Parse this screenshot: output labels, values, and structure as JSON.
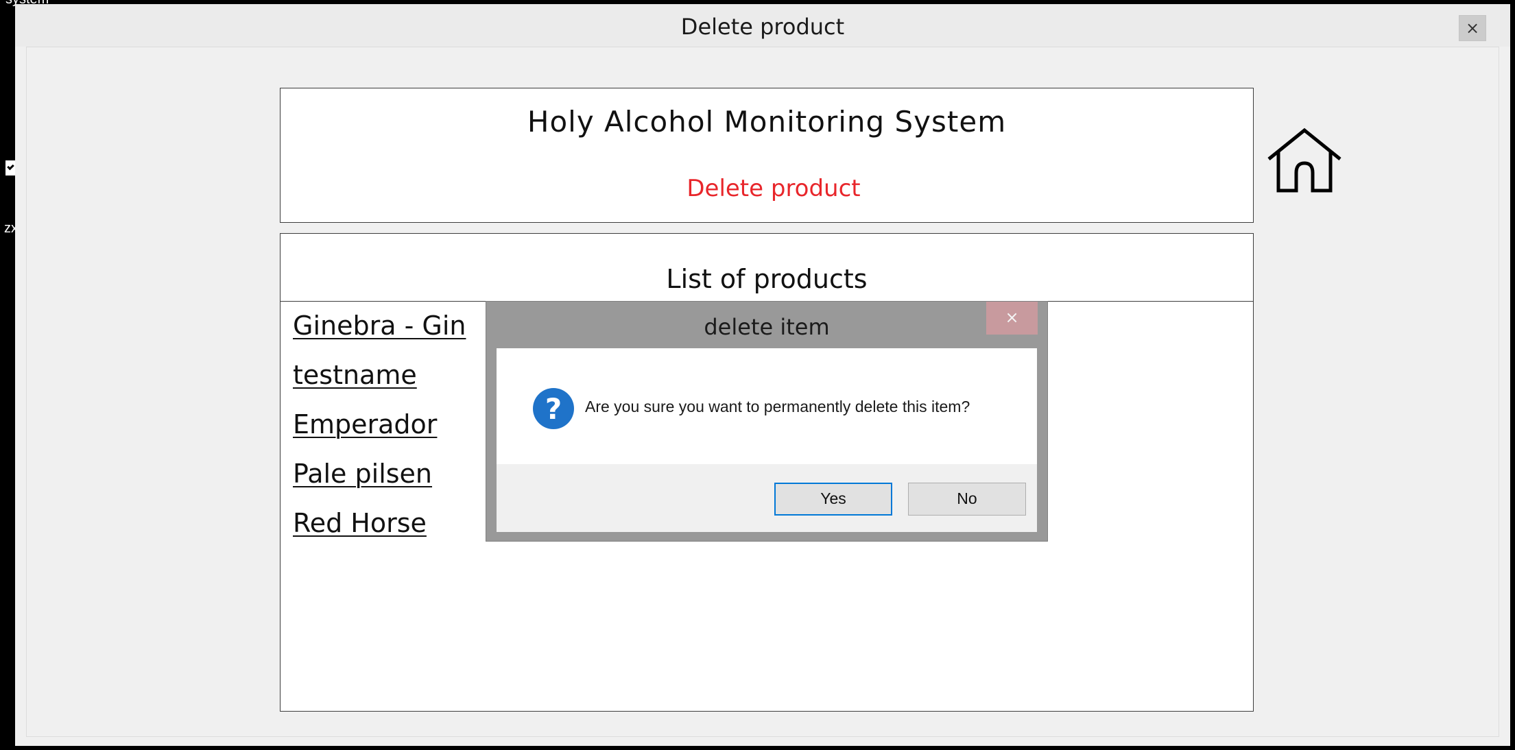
{
  "desktop": {
    "top_text": "system",
    "side_text": "zx"
  },
  "window": {
    "title": "Delete product",
    "close_glyph": "×"
  },
  "header": {
    "app_title": "Holy Alcohol Monitoring System",
    "page_subtitle": "Delete product",
    "subtitle_color": "#e8262b"
  },
  "home": {
    "icon": "home-icon"
  },
  "product_list": {
    "title": "List of products",
    "items": [
      "Ginebra - Gin",
      "testname",
      "Emperador",
      "Pale pilsen",
      "Red Horse"
    ]
  },
  "dialog": {
    "title": "delete item",
    "close_glyph": "×",
    "icon": "question-icon",
    "message": "Are you sure you want to permanently delete this item?",
    "yes_label": "Yes",
    "no_label": "No",
    "focused_button": "Yes",
    "accent_color": "#0078d7"
  }
}
